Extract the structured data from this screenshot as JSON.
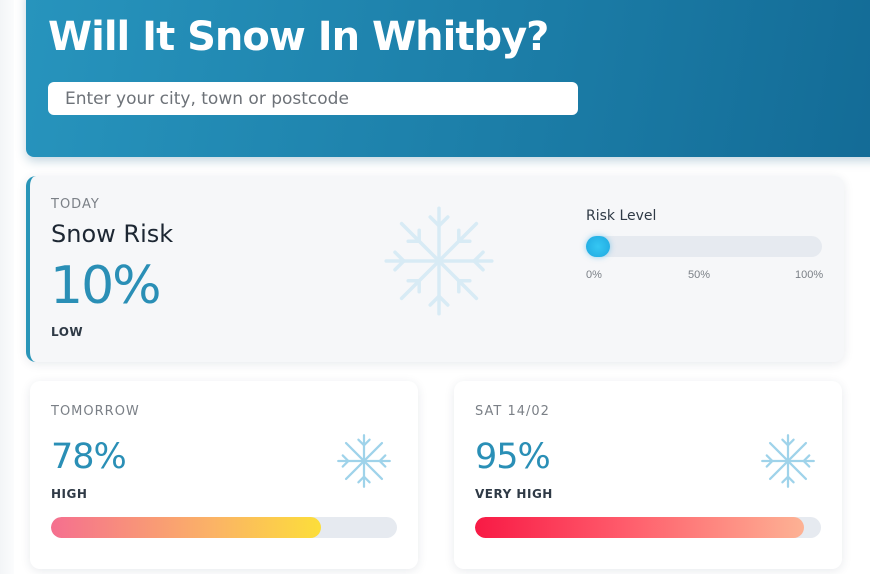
{
  "header": {
    "title": "Will It Snow In Whitby?",
    "search_placeholder": "Enter your city, town or postcode"
  },
  "today": {
    "day_label": "TODAY",
    "heading": "Snow Risk",
    "percent": "10%",
    "level": "LOW",
    "risk_meter": {
      "title": "Risk Level",
      "ticks": [
        "0%",
        "50%",
        "100%"
      ],
      "value_fraction": 0.05
    }
  },
  "forecast": [
    {
      "day_label": "TOMORROW",
      "percent": "78%",
      "level": "HIGH",
      "risk_fraction": 0.78
    },
    {
      "day_label": "SAT 14/02",
      "percent": "95%",
      "level": "VERY HIGH",
      "risk_fraction": 0.95
    }
  ],
  "colors": {
    "header_gradient_start": "#2794bd",
    "header_gradient_end": "#136b96",
    "percent_text": "#2a8fb6",
    "meter_knob": "#1fa8e0",
    "high_gradient": [
      "#f56f8f",
      "#fbb366",
      "#fcde3a"
    ],
    "very_high_gradient": [
      "#f81a45",
      "#ff5b6b",
      "#fdb294"
    ]
  },
  "icons": [
    "snowflake-icon"
  ]
}
